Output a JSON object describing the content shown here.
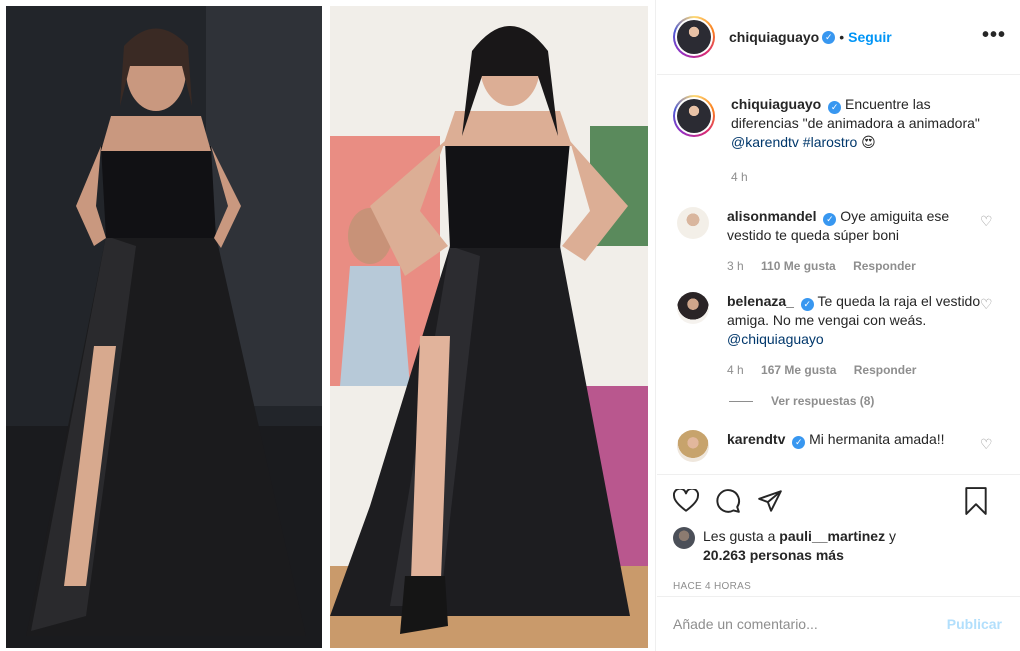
{
  "post": {
    "username": "chiquiaguayo",
    "follow_label": "Seguir",
    "separator": "•",
    "more_label": "•••",
    "verified_glyph": "✓"
  },
  "caption": {
    "username": "chiquiaguayo",
    "text": "Encuentre las diferencias \"de animadora a animadora\"",
    "mentions": "@karendtv #larostro",
    "emoji": "😍",
    "time": "4 h"
  },
  "comments": [
    {
      "username": "alisonmandel",
      "text": "Oye amiguita ese vestido te queda súper boni",
      "time": "3 h",
      "likes": "110 Me gusta",
      "reply": "Responder"
    },
    {
      "username": "belenaza_",
      "text": "Te queda la raja el vestido amiga. No me vengai con weás.",
      "mention": "@chiquiaguayo",
      "time": "4 h",
      "likes": "167 Me gusta",
      "reply": "Responder",
      "view_replies": "Ver respuestas (8)"
    },
    {
      "username": "karendtv",
      "text": "Mi hermanita amada!!"
    }
  ],
  "likes": {
    "prefix": "Les gusta a",
    "user": "pauli__martinez",
    "joiner": "y",
    "others": "20.263 personas más"
  },
  "timestamp": "HACE 4 HORAS",
  "add_comment": {
    "placeholder": "Añade un comentario...",
    "publish_label": "Publicar"
  },
  "colors": {
    "link": "#0095f6",
    "verified": "#3897f0",
    "publish_disabled": "#b2dffc",
    "muted": "#8e8e8e"
  },
  "icons": [
    "heart-icon",
    "comment-icon",
    "share-icon",
    "bookmark-icon",
    "more-options-icon",
    "verified-icon"
  ]
}
